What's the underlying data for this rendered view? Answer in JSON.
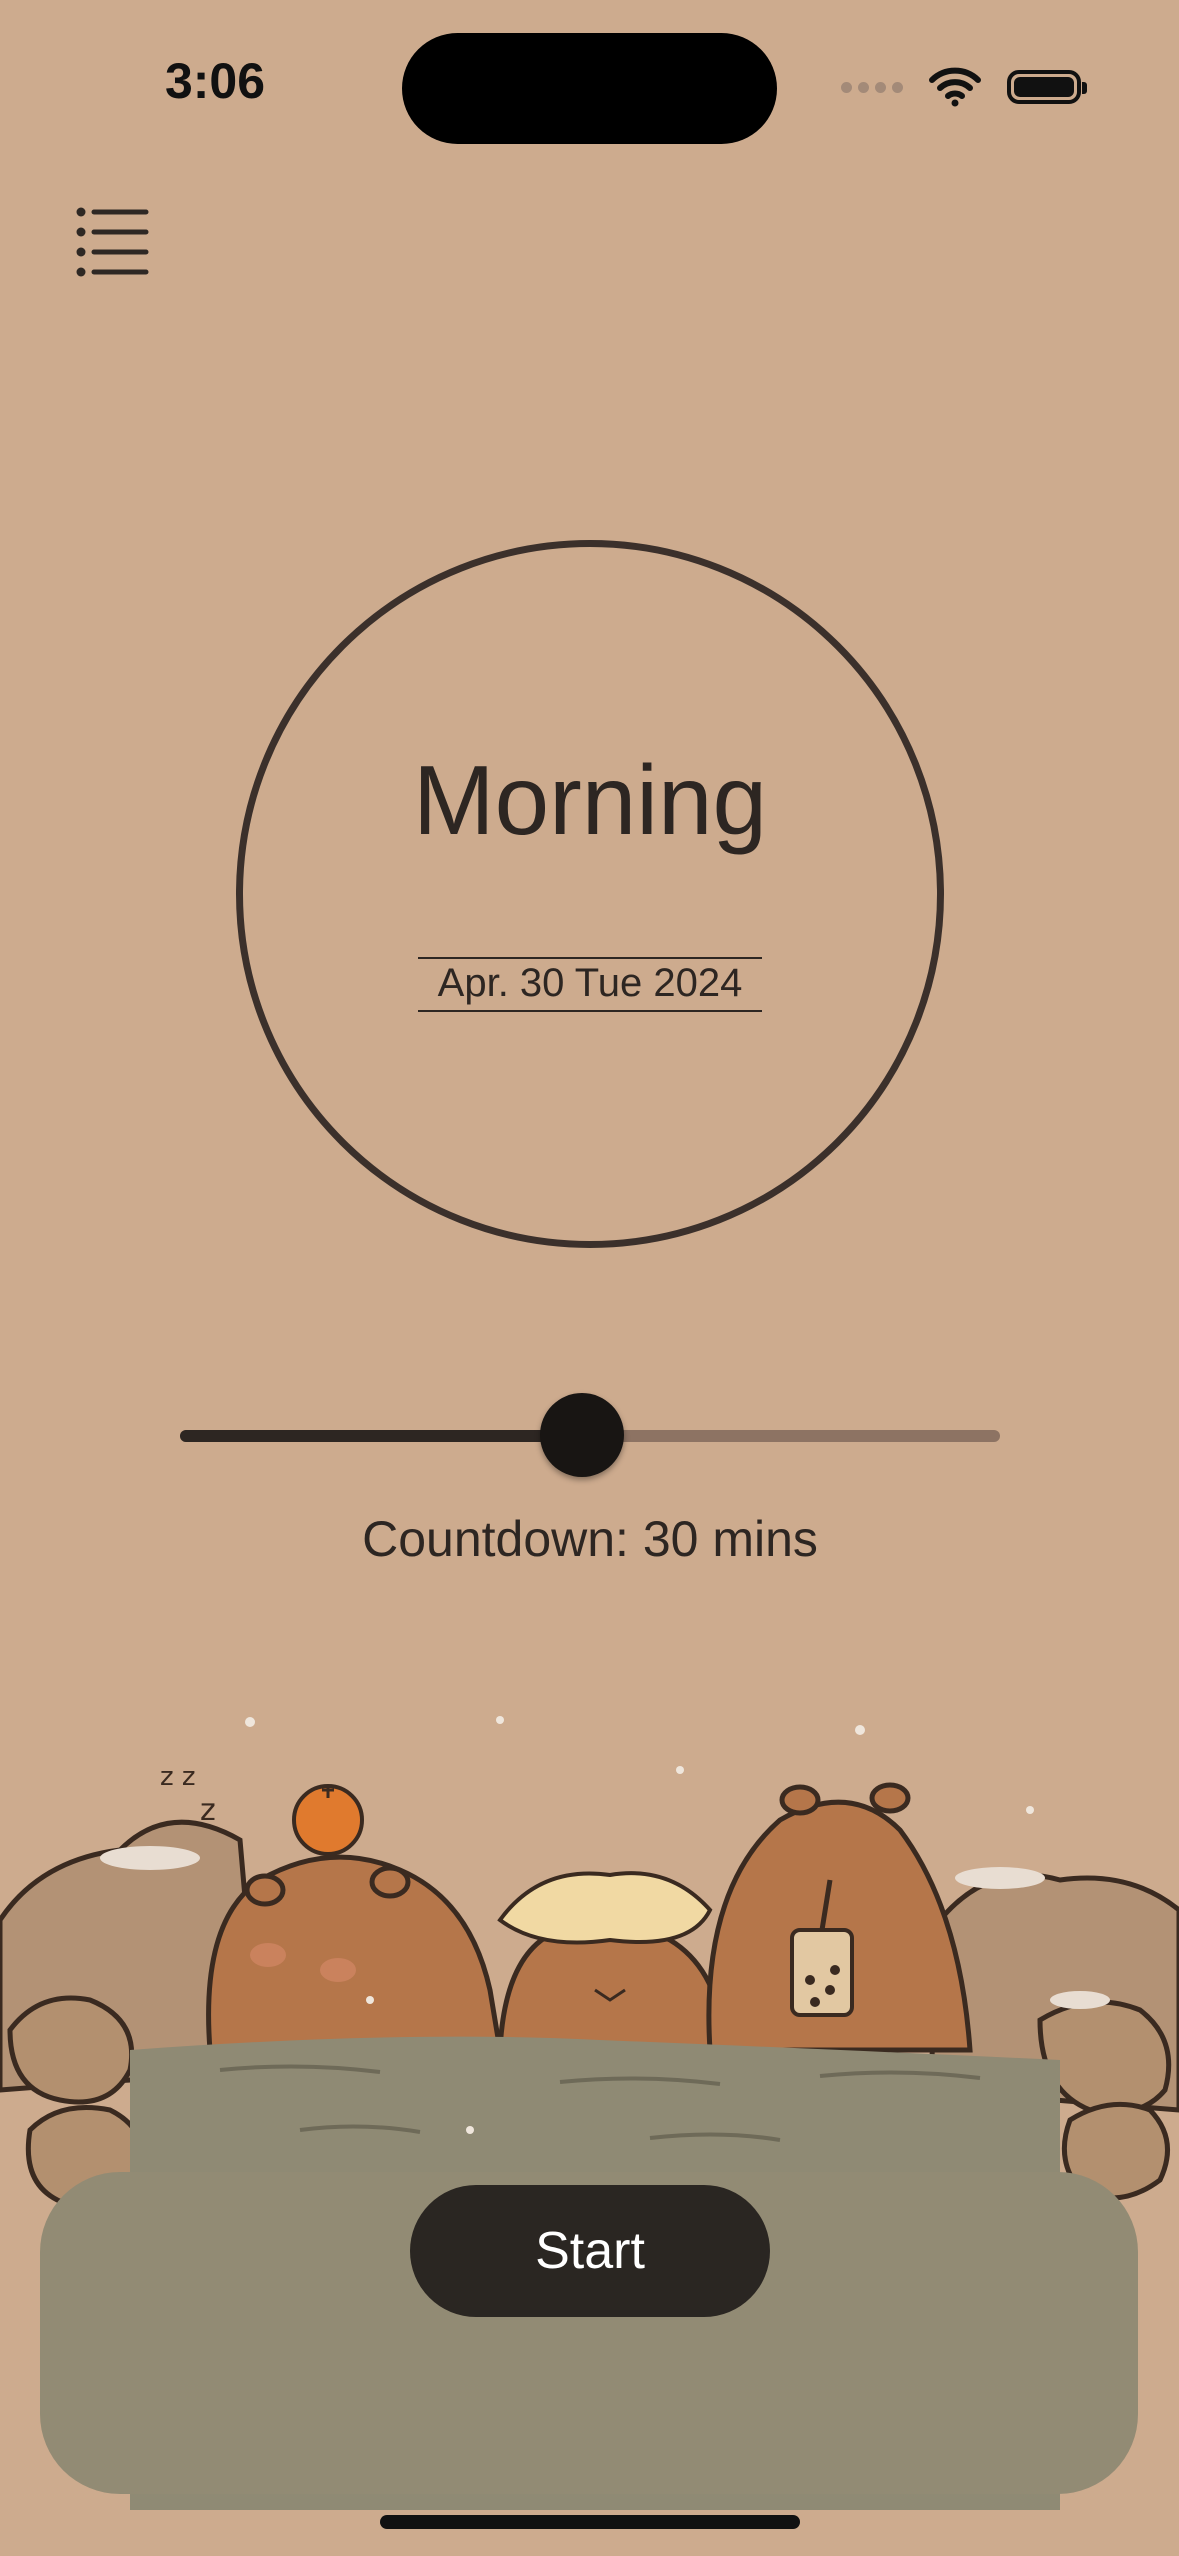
{
  "status_bar": {
    "time": "3:06"
  },
  "main": {
    "period": "Morning",
    "date": "Apr. 30 Tue 2024",
    "countdown_label": "Countdown: 30 mins",
    "slider_value": 0.49
  },
  "actions": {
    "start_label": "Start"
  },
  "icons": {
    "menu": "list-icon",
    "wifi": "wifi-icon",
    "battery": "battery-icon",
    "signal": "signal-dots-icon"
  },
  "colors": {
    "background": "#cdab8e",
    "ink": "#2d2622",
    "button": "#2a2622",
    "water": "#8f8a74"
  }
}
